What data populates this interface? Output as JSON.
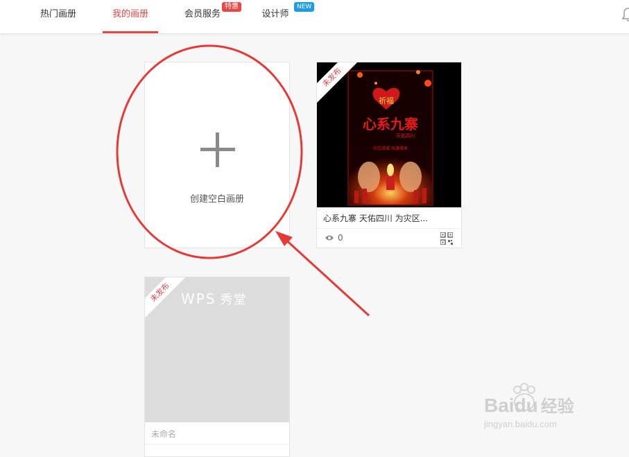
{
  "nav": {
    "items": [
      {
        "label": "热门画册"
      },
      {
        "label": "我的画册"
      },
      {
        "label": "会员服务",
        "badge": "特惠"
      },
      {
        "label": "设计师",
        "badge": "NEW"
      }
    ],
    "active_index": 1
  },
  "create_card": {
    "label": "创建空白画册"
  },
  "albums": [
    {
      "status": "未发布",
      "title": "心系九寨 天佑四川 为灾区...",
      "views": "0",
      "poster": {
        "top_text": "祈福",
        "main_text": "心系九寨",
        "sub_text": "天佑四川",
        "caption": "众志成城 共渡难关"
      }
    },
    {
      "status": "未发布",
      "title": "未命名",
      "cover_brand": "WPS",
      "cover_brand_sub": "秀堂"
    }
  ],
  "watermark": {
    "brand": "Baidu",
    "brand_cn": "经验",
    "url": "jingyan.baidu.com"
  },
  "colors": {
    "accent": "#e84545",
    "new_badge": "#1e9be8",
    "annotation": "#e53935"
  }
}
